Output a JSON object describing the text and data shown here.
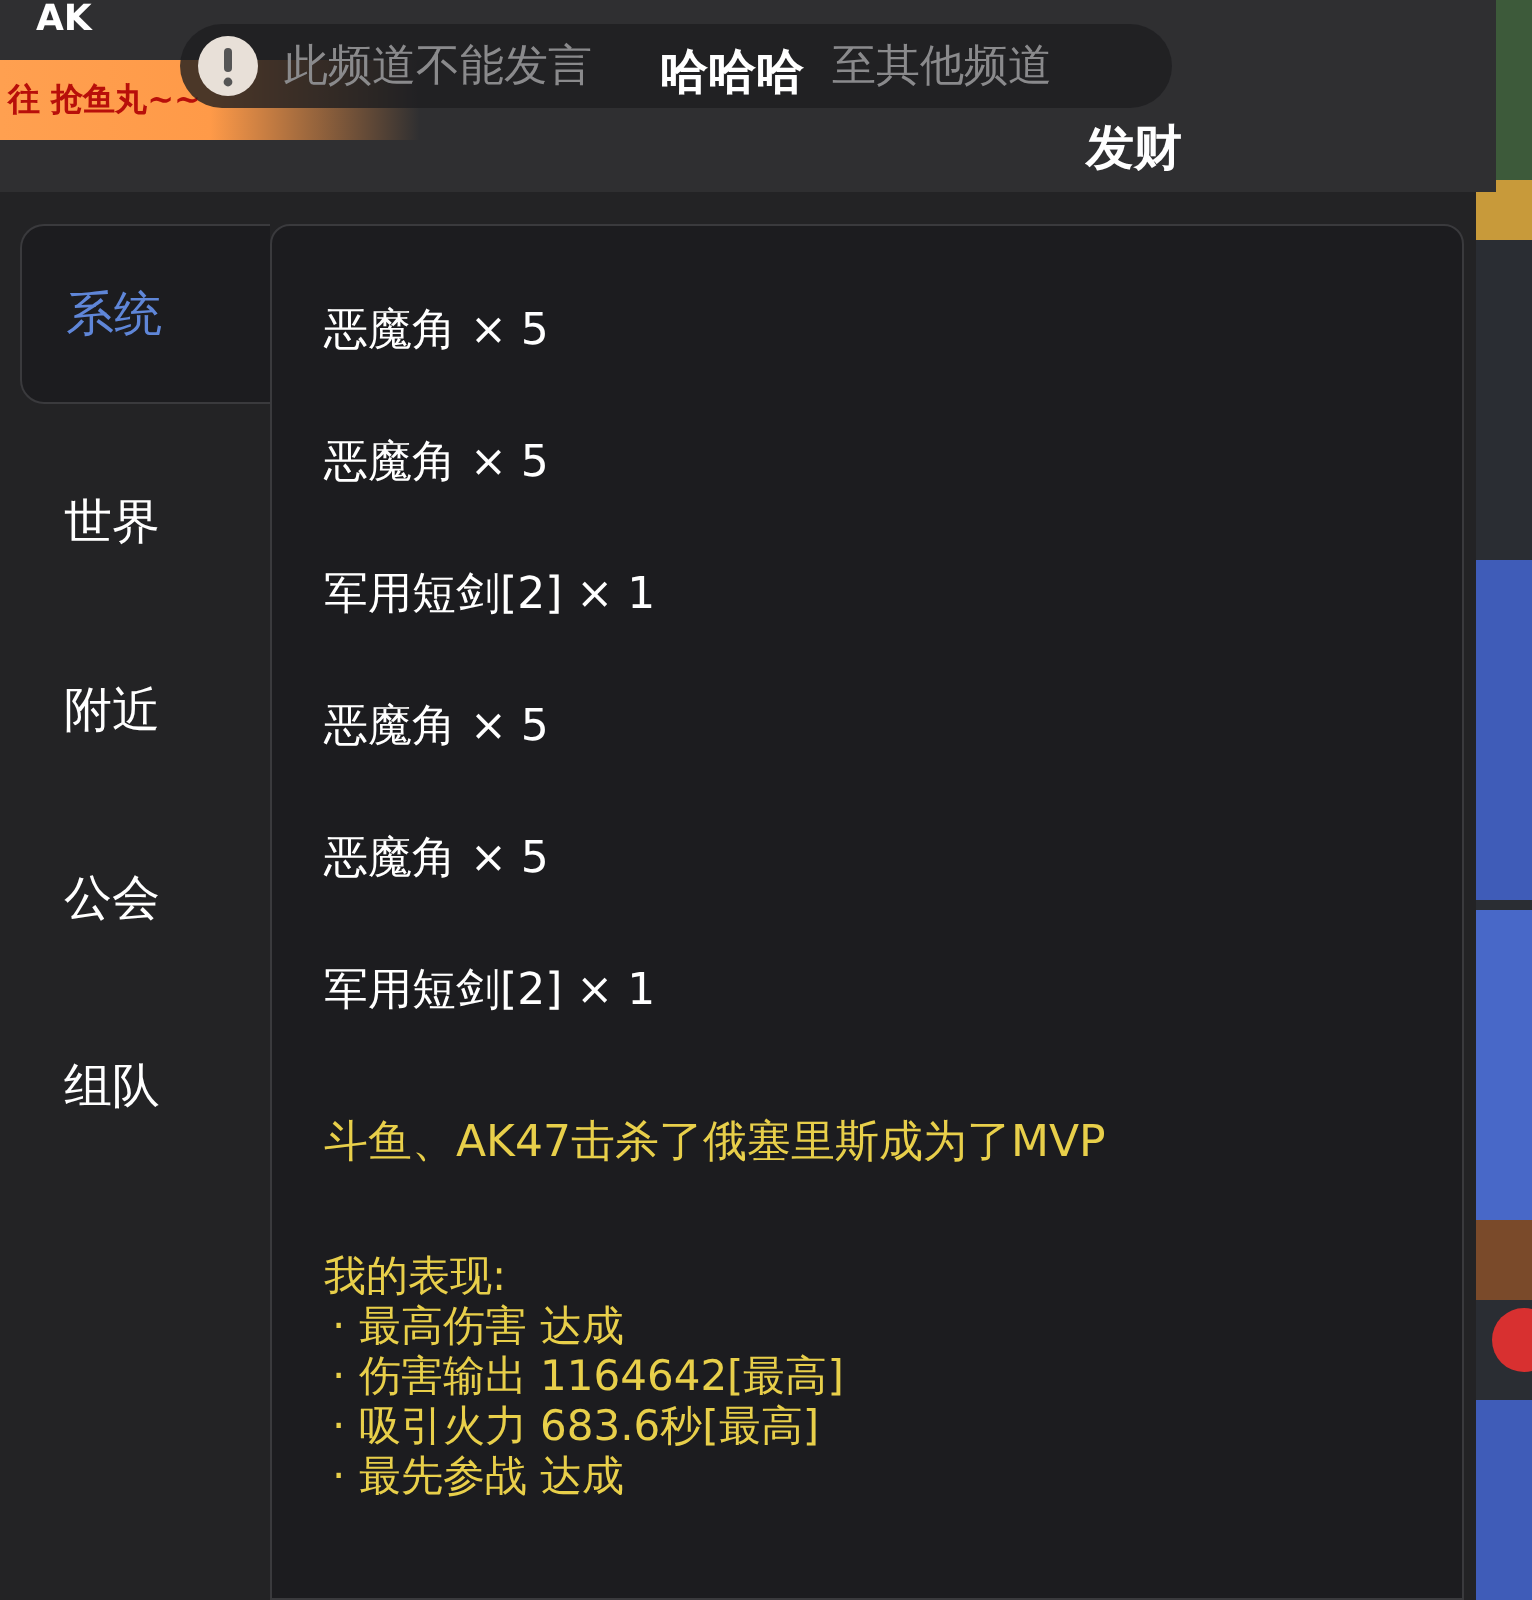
{
  "top_bar": {
    "player_tag": "AK",
    "banner": "往 抢鱼丸~~",
    "notice": {
      "parts": [
        "此频道不能发言",
        "至其他频道"
      ]
    }
  },
  "danmaku": [
    {
      "text": "哈哈哈"
    },
    {
      "text": "发财"
    }
  ],
  "tabs": [
    {
      "label": "系统",
      "selected": true
    },
    {
      "label": "世界",
      "selected": false
    },
    {
      "label": "附近",
      "selected": false
    },
    {
      "label": "公会",
      "selected": false
    },
    {
      "label": "组队",
      "selected": false
    }
  ],
  "messages": [
    {
      "kind": "item",
      "text": "恶魔角 × 5"
    },
    {
      "kind": "item",
      "text": "恶魔角 × 5"
    },
    {
      "kind": "item",
      "text": "军用短剑[2] × 1"
    },
    {
      "kind": "item",
      "text": "恶魔角 × 5"
    },
    {
      "kind": "item",
      "text": "恶魔角 × 5"
    },
    {
      "kind": "item",
      "text": "军用短剑[2] × 1"
    },
    {
      "kind": "system",
      "text": "斗鱼、AK47击杀了俄塞里斯成为了MVP"
    }
  ],
  "performance": {
    "title": "我的表现:",
    "lines": [
      "· 最高伤害 达成",
      "· 伤害输出 1164642[最高]",
      "· 吸引火力 683.6秒[最高]",
      "· 最先参战 达成"
    ]
  }
}
